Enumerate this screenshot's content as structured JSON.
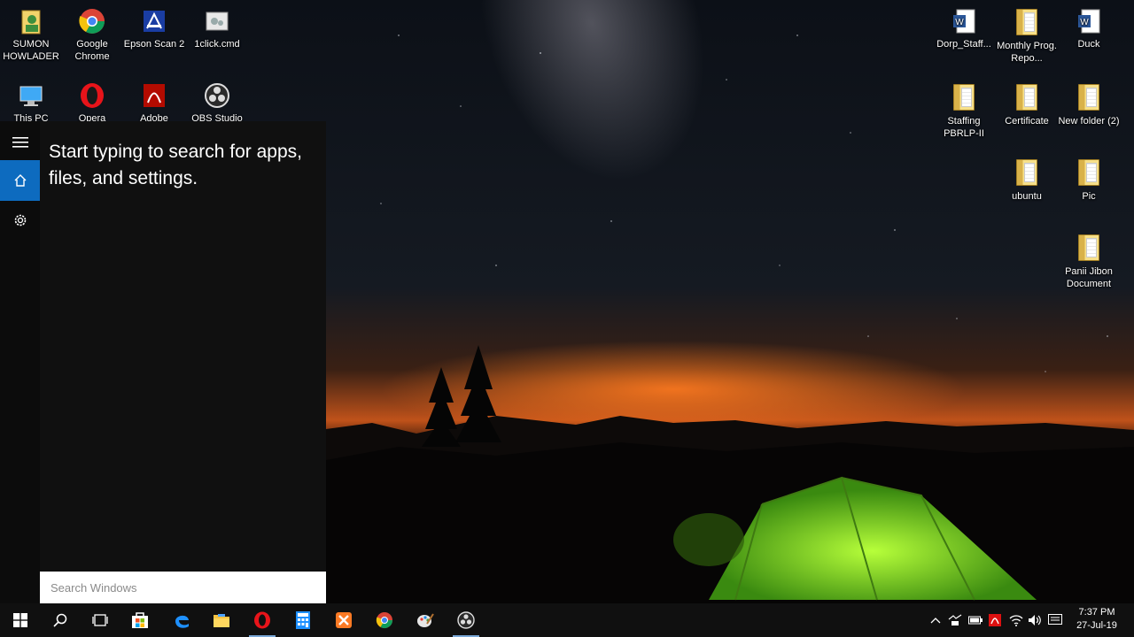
{
  "desktop": {
    "left_icons": [
      {
        "label": "SUMON HOWLADER",
        "icon": "user-folder-icon"
      },
      {
        "label": "Google Chrome",
        "icon": "chrome-icon"
      },
      {
        "label": "Epson Scan 2",
        "icon": "epson-scan-icon"
      },
      {
        "label": "1click.cmd",
        "icon": "cmd-file-icon"
      },
      {
        "label": "This PC",
        "icon": "this-pc-icon"
      },
      {
        "label": "Opera",
        "icon": "opera-icon"
      },
      {
        "label": "Adobe",
        "icon": "adobe-icon"
      },
      {
        "label": "OBS Studio",
        "icon": "obs-icon"
      }
    ],
    "right_icons": [
      {
        "label": "Dorp_Staff...",
        "icon": "word-doc-icon"
      },
      {
        "label": "Monthly Prog. Repo...",
        "icon": "folder-icon"
      },
      {
        "label": "Duck",
        "icon": "word-doc-icon"
      },
      {
        "label": "Staffing PBRLP-II",
        "icon": "folder-icon"
      },
      {
        "label": "Certificate",
        "icon": "folder-icon"
      },
      {
        "label": "New folder (2)",
        "icon": "folder-icon"
      },
      {
        "label": "ubuntu",
        "icon": "folder-icon"
      },
      {
        "label": "Pic",
        "icon": "folder-icon"
      },
      {
        "label": "Panii Jibon Document",
        "icon": "folder-icon"
      }
    ]
  },
  "start_menu": {
    "search_hint": "Start typing to search for apps, files, and settings.",
    "search_placeholder": "Search Windows",
    "rail": [
      "hamburger-icon",
      "home-icon",
      "settings-icon"
    ]
  },
  "taskbar": {
    "pinned": [
      {
        "name": "search",
        "icon": "search-icon"
      },
      {
        "name": "task-view",
        "icon": "task-view-icon"
      },
      {
        "name": "store",
        "icon": "store-icon"
      },
      {
        "name": "edge",
        "icon": "edge-icon"
      },
      {
        "name": "file-explorer",
        "icon": "folder-icon"
      },
      {
        "name": "opera",
        "icon": "opera-icon"
      },
      {
        "name": "calculator",
        "icon": "calculator-icon"
      },
      {
        "name": "xampp",
        "icon": "xampp-icon"
      },
      {
        "name": "chrome",
        "icon": "chrome-icon"
      },
      {
        "name": "paint",
        "icon": "paint-icon"
      },
      {
        "name": "obs",
        "icon": "obs-icon"
      }
    ],
    "clock_time": "7:37 PM",
    "clock_date": "27-Jul-19"
  },
  "colors": {
    "accent": "#0d6bbf",
    "panel": "#101010",
    "taskbar": "#101010",
    "tent": "#7be033"
  }
}
